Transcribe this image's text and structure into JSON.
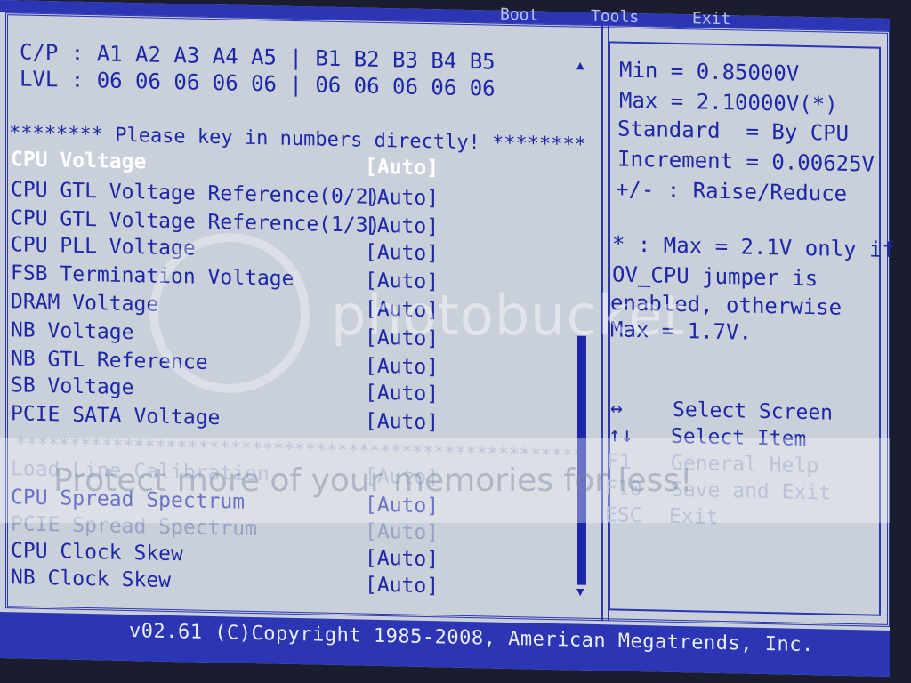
{
  "menu": {
    "items": [
      "Boot",
      "Tools",
      "Exit"
    ]
  },
  "header": {
    "cp_line": "C/P : A1 A2 A3 A4 A5 | B1 B2 B3 B4 B5",
    "lvl_line": "LVL : 06 06 06 06 06 | 06 06 06 06 06",
    "instruction": "******** Please key in numbers directly! ********"
  },
  "voltage_items": [
    {
      "label": "CPU Voltage",
      "value": "[Auto]"
    },
    {
      "label": "CPU GTL Voltage Reference(0/2)",
      "value": "[Auto]"
    },
    {
      "label": "CPU GTL Voltage Reference(1/3)",
      "value": "[Auto]"
    },
    {
      "label": "CPU PLL Voltage",
      "value": "[Auto]"
    },
    {
      "label": "FSB Termination Voltage",
      "value": "[Auto]"
    },
    {
      "label": "DRAM Voltage",
      "value": "[Auto]"
    },
    {
      "label": "NB Voltage",
      "value": "[Auto]"
    },
    {
      "label": "NB GTL Reference",
      "value": "[Auto]"
    },
    {
      "label": "SB Voltage",
      "value": "[Auto]"
    },
    {
      "label": "PCIE SATA Voltage",
      "value": "[Auto]"
    }
  ],
  "separator": "*****************************************************",
  "other_items": [
    {
      "label": "Load-Line Calibration",
      "value": "[Auto]"
    },
    {
      "label": "CPU Spread Spectrum",
      "value": "[Auto]"
    },
    {
      "label": "PCIE Spread Spectrum",
      "value": "[Auto]"
    },
    {
      "label": "CPU Clock Skew",
      "value": "[Auto]"
    },
    {
      "label": "NB Clock Skew",
      "value": "[Auto]"
    }
  ],
  "help": {
    "lines": [
      "Min = 0.85000V",
      "Max = 2.10000V(*)",
      "Standard  = By CPU",
      "Increment = 0.00625V",
      "+/- : Raise/Reduce"
    ],
    "note_lines": [
      "* : Max = 2.1V only if",
      "OV_CPU jumper is",
      "enabled, otherwise",
      "Max = 1.7V."
    ]
  },
  "keys": [
    {
      "key": "↔",
      "desc": "Select Screen"
    },
    {
      "key": "↑↓",
      "desc": "Select Item"
    },
    {
      "key": "F1",
      "desc": "General Help"
    },
    {
      "key": "F10",
      "desc": "Save and Exit"
    },
    {
      "key": "ESC",
      "desc": "Exit"
    }
  ],
  "footer": {
    "copyright": "v02.61 (C)Copyright 1985-2008, American Megatrends, Inc."
  },
  "watermark": {
    "text": "photobucket",
    "banner": "Protect more of your memories for less!"
  }
}
